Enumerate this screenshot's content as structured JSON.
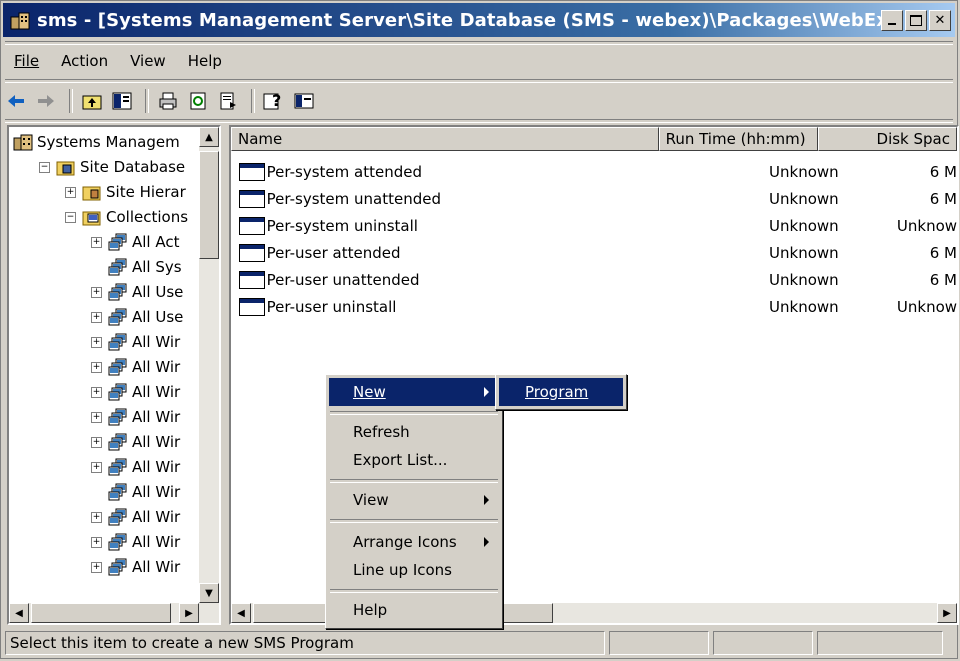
{
  "window": {
    "title": "sms - [Systems Management Server\\Site Database (SMS - webex)\\Packages\\WebEx Com...",
    "controls": [
      "minimize-icon",
      "maximize-icon",
      "close-icon"
    ]
  },
  "menubar": [
    {
      "label": "File"
    },
    {
      "label": "Action"
    },
    {
      "label": "View"
    },
    {
      "label": "Help"
    }
  ],
  "toolbar": [
    "back-icon",
    "forward-icon",
    "up-level-icon",
    "show-hide-tree-icon",
    "print-icon",
    "refresh-icon",
    "export-list-icon",
    "help-icon",
    "console-view-icon"
  ],
  "tree": {
    "items": [
      {
        "label": "Systems Managem",
        "indent": 0,
        "expander": "",
        "icon": "sms-icon"
      },
      {
        "label": "Site Database",
        "indent": 1,
        "expander": "−",
        "icon": "database-icon"
      },
      {
        "label": "Site Hierar",
        "indent": 2,
        "expander": "+",
        "icon": "site-hierarchy-icon"
      },
      {
        "label": "Collections",
        "indent": 2,
        "expander": "−",
        "icon": "collections-icon"
      },
      {
        "label": "All Act",
        "indent": 3,
        "expander": "+",
        "icon": "collection-icon"
      },
      {
        "label": "All Sys",
        "indent": 3,
        "expander": "",
        "icon": "collection-icon"
      },
      {
        "label": "All Use",
        "indent": 3,
        "expander": "+",
        "icon": "collection-icon"
      },
      {
        "label": "All Use",
        "indent": 3,
        "expander": "+",
        "icon": "collection-icon"
      },
      {
        "label": "All Wir",
        "indent": 3,
        "expander": "+",
        "icon": "collection-icon"
      },
      {
        "label": "All Wir",
        "indent": 3,
        "expander": "+",
        "icon": "collection-icon"
      },
      {
        "label": "All Wir",
        "indent": 3,
        "expander": "+",
        "icon": "collection-icon"
      },
      {
        "label": "All Wir",
        "indent": 3,
        "expander": "+",
        "icon": "collection-icon"
      },
      {
        "label": "All Wir",
        "indent": 3,
        "expander": "+",
        "icon": "collection-icon"
      },
      {
        "label": "All Wir",
        "indent": 3,
        "expander": "+",
        "icon": "collection-icon"
      },
      {
        "label": "All Wir",
        "indent": 3,
        "expander": "",
        "icon": "collection-icon"
      },
      {
        "label": "All Wir",
        "indent": 3,
        "expander": "+",
        "icon": "collection-icon"
      },
      {
        "label": "All Wir",
        "indent": 3,
        "expander": "+",
        "icon": "collection-icon"
      },
      {
        "label": "All Wir",
        "indent": 3,
        "expander": "+",
        "icon": "collection-icon"
      }
    ]
  },
  "list": {
    "columns": [
      "Name",
      "Run Time (hh:mm)",
      "Disk Spac"
    ],
    "rows": [
      {
        "name": "Per-system attended",
        "runtime": "Unknown",
        "disk": "6 M"
      },
      {
        "name": "Per-system unattended",
        "runtime": "Unknown",
        "disk": "6 M"
      },
      {
        "name": "Per-system uninstall",
        "runtime": "Unknown",
        "disk": "Unknow"
      },
      {
        "name": "Per-user attended",
        "runtime": "Unknown",
        "disk": "6 M"
      },
      {
        "name": "Per-user unattended",
        "runtime": "Unknown",
        "disk": "6 M"
      },
      {
        "name": "Per-user uninstall",
        "runtime": "Unknown",
        "disk": "Unknow"
      }
    ]
  },
  "context_menu": {
    "items": [
      {
        "label": "New",
        "accel": "N",
        "submenu": true,
        "selected": true
      },
      {
        "label": "Refresh",
        "accel": "f",
        "submenu": false
      },
      {
        "label": "Export List...",
        "accel": "L",
        "submenu": false
      },
      {
        "label": "View",
        "accel": "V",
        "submenu": true
      },
      {
        "label": "Arrange Icons",
        "accel": "I",
        "submenu": true
      },
      {
        "label": "Line up Icons",
        "accel": "n",
        "submenu": false
      },
      {
        "label": "Help",
        "accel": "H",
        "submenu": false
      }
    ],
    "submenu": {
      "label": "Program",
      "selected": true
    }
  },
  "statusbar": {
    "text": "Select this item to create a new SMS Program"
  },
  "colors": {
    "title_start": "#0a246a",
    "title_end": "#a6caf0",
    "face": "#d4d0c8",
    "selection": "#0a246a"
  }
}
